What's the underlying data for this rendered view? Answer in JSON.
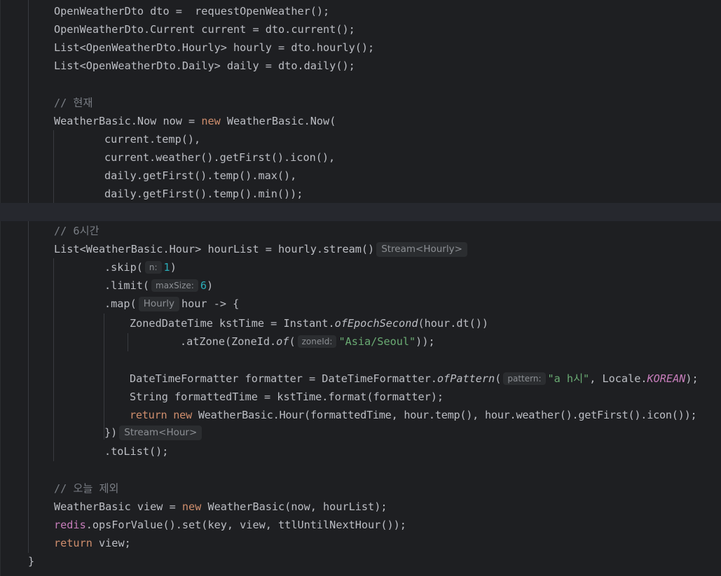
{
  "editor": {
    "lines": [
      {
        "code": "OpenWeatherDto dto =  requestOpenWeather();"
      },
      {
        "code": "OpenWeatherDto.Current current = dto.current();"
      },
      {
        "code": "List<OpenWeatherDto.Hourly> hourly = dto.hourly();"
      },
      {
        "code": "List<OpenWeatherDto.Daily> daily = dto.daily();"
      },
      {
        "comment": "// 현재"
      },
      {
        "pre": "WeatherBasic.Now now = ",
        "kw": "new",
        "post": " WeatherBasic.Now("
      },
      {
        "code": "current.temp(),"
      },
      {
        "code": "current.weather().getFirst().icon(),"
      },
      {
        "code": "daily.getFirst().temp().max(),"
      },
      {
        "code": "daily.getFirst().temp().min());"
      },
      {
        "comment": "// 6시간"
      },
      {
        "code": "List<WeatherBasic.Hour> hourList = hourly.stream()",
        "hint": "Stream<Hourly>"
      },
      {
        "pre": ".skip(",
        "hint": "n:",
        "num": "1",
        "post": ")"
      },
      {
        "pre": ".limit(",
        "hint": "maxSize:",
        "num": "6",
        "post": ")"
      },
      {
        "pre": ".map(",
        "hint": "Hourly",
        "post": "hour -> {"
      },
      {
        "pre": "ZonedDateTime kstTime = Instant.",
        "it": "ofEpochSecond",
        "post": "(hour.dt())"
      },
      {
        "pre": ".atZone(ZoneId.",
        "it": "of",
        "mid": "(",
        "hint": "zoneId:",
        "str": "\"Asia/Seoul\"",
        "post": "));"
      },
      {
        "pre": "DateTimeFormatter formatter = DateTimeFormatter.",
        "it": "ofPattern",
        "mid": "(",
        "hint": "pattern:",
        "str": "\"a h시\"",
        "post": ", Locale.",
        "field": "KOREAN",
        "tail": ");"
      },
      {
        "code": "String formattedTime = kstTime.format(formatter);"
      },
      {
        "kw1": "return",
        "gap": " ",
        "kw2": "new",
        "post": " WeatherBasic.Hour(formattedTime, hour.temp(), hour.weather().getFirst().icon());"
      },
      {
        "code": "})",
        "hint": "Stream<Hour>"
      },
      {
        "code": ".toList();"
      },
      {
        "comment": "// 오늘 제외"
      },
      {
        "pre": "WeatherBasic view = ",
        "kw": "new",
        "post": " WeatherBasic(now, hourList);"
      },
      {
        "field": "redis",
        "post": ".opsForValue().set(key, view, ttlUntilNextHour());"
      },
      {
        "kw": "return",
        "post": " view;"
      },
      {
        "code": "}"
      }
    ]
  },
  "colors": {
    "background": "#1e1f22",
    "current_line": "#26282e",
    "default_text": "#bcbec4",
    "comment": "#7a7e85",
    "keyword": "#cf8e6d",
    "string": "#6aab73",
    "number": "#2aacb8",
    "field": "#c77dbb",
    "inlay_hint_bg": "#2b2d30",
    "inlay_hint_text": "#8c8f94"
  }
}
